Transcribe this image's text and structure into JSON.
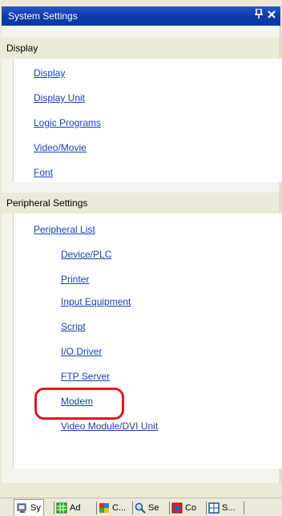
{
  "window": {
    "title": "System Settings",
    "pin_glyph": "↑",
    "close_glyph": "x"
  },
  "groups": [
    {
      "header": "Display",
      "items": [
        "Display",
        "Display Unit",
        "Logic Programs",
        "Video/Movie",
        "Font"
      ]
    },
    {
      "header": "Peripheral Settings",
      "parent_item": "Peripheral List",
      "items": [
        "Device/PLC",
        "Printer",
        "Input Equipment",
        "Script",
        "I/O Driver",
        "FTP Server",
        "Modem",
        "Video Module/DVI Unit"
      ]
    }
  ],
  "highlighted_item": "Modem",
  "tabs": [
    {
      "label": "Sy",
      "icon": "system-settings-icon",
      "active": true
    },
    {
      "label": "Ad",
      "icon": "address-grid-icon",
      "active": false
    },
    {
      "label": "C...",
      "icon": "common-settings-icon",
      "active": false
    },
    {
      "label": "Se",
      "icon": "search-icon",
      "active": false
    },
    {
      "label": "Co",
      "icon": "comment-icon",
      "active": false
    },
    {
      "label": "S...",
      "icon": "screen-list-icon",
      "active": false
    }
  ],
  "colors": {
    "title_bar": "#0a3aa8",
    "link": "#1a3fb5",
    "highlight": "#e0181b"
  }
}
